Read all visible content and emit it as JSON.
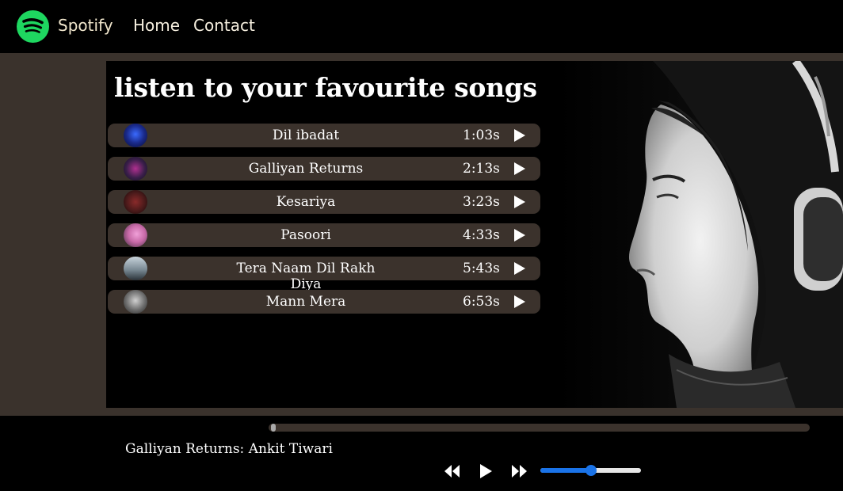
{
  "nav": {
    "brand": "Spotify",
    "links": [
      "Home",
      "Contact"
    ],
    "brand_color": "#1ed760"
  },
  "main": {
    "heading": "listen to your favourite songs",
    "songs": [
      {
        "name": "Dil ibadat",
        "duration": "1:03s",
        "cover_color": "#1a2a8a"
      },
      {
        "name": "Galliyan Returns",
        "duration": "2:13s",
        "cover_color": "#3a1f4a"
      },
      {
        "name": "Kesariya",
        "duration": "3:23s",
        "cover_color": "#4a1a1a"
      },
      {
        "name": "Pasoori",
        "duration": "4:33s",
        "cover_color": "#c86aa8"
      },
      {
        "name": "Tera Naam Dil Rakh Diya",
        "duration": "5:43s",
        "cover_color": "#7a8a94"
      },
      {
        "name": "Mann Mera",
        "duration": "6:53s",
        "cover_color": "#6a6a6a"
      }
    ]
  },
  "player": {
    "now_playing": "Galliyan Returns: Ankit Tiwari",
    "progress": 0.005,
    "volume": 0.5,
    "controls": [
      "rewind-icon",
      "play-icon",
      "fast-forward-icon"
    ],
    "accent_color": "#1a73e8"
  }
}
